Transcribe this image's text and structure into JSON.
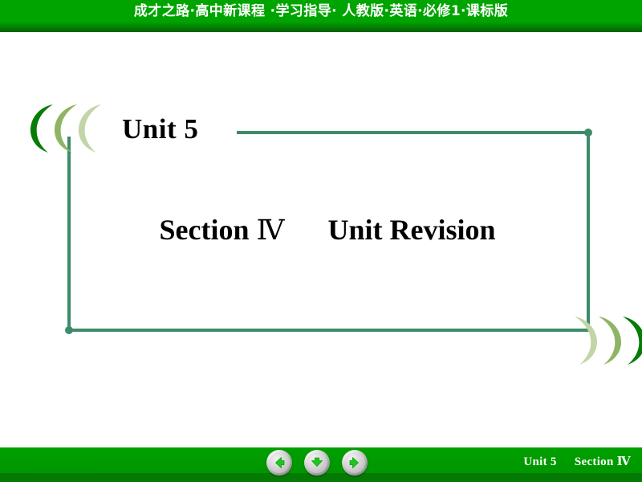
{
  "header": {
    "title": "成才之路·高中新课程 ·学习指导· 人教版·英语·必修1·课标版",
    "bg_color": "#00a400"
  },
  "slide": {
    "unit_label": "Unit 5",
    "title_section": "Section",
    "title_roman": "Ⅳ",
    "title_main": "Unit Revision",
    "frame_color": "#3d8c69"
  },
  "decorations": {
    "top_left": {
      "name": "left-chevron-cluster",
      "colors": [
        "#067d06",
        "#8fb564",
        "#c3d5a7"
      ]
    },
    "bottom_right": {
      "name": "right-chevron-cluster",
      "colors": [
        "#c3d5a7",
        "#8fb564",
        "#067d06"
      ]
    }
  },
  "footer": {
    "nav": [
      {
        "name": "previous",
        "icon": "arrow-left-icon",
        "label": "Previous slide"
      },
      {
        "name": "down",
        "icon": "arrow-down-icon",
        "label": "Next section"
      },
      {
        "name": "next",
        "icon": "arrow-right-icon",
        "label": "Next slide"
      }
    ],
    "unit_label": "Unit 5",
    "section_label": "Section",
    "section_roman": "Ⅳ",
    "arrow_color": "#1ec81e",
    "bg_color": "#00a000"
  }
}
